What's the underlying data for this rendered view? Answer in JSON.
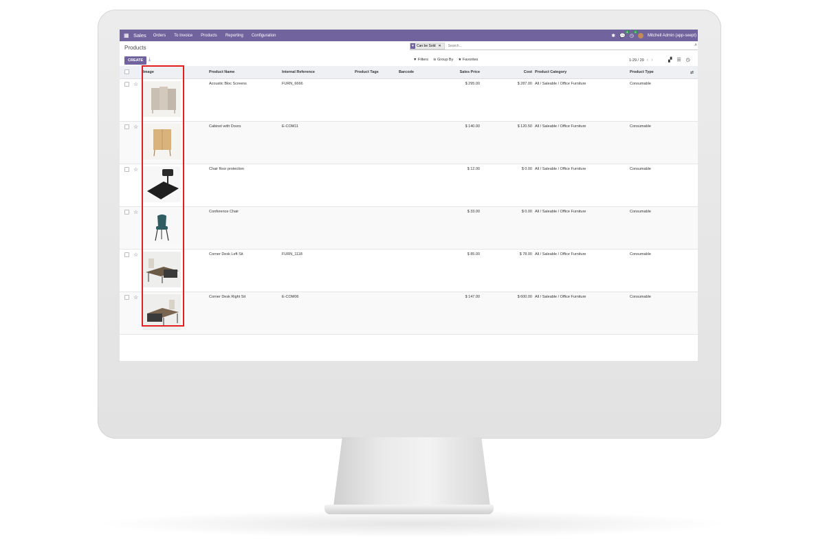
{
  "navbar": {
    "app_name": "Sales",
    "menu": [
      "Orders",
      "To Invoice",
      "Products",
      "Reporting",
      "Configuration"
    ],
    "chat_badge": "4",
    "activity_badge": "2",
    "user": "Mitchell Admin (app-seept)"
  },
  "control_panel": {
    "breadcrumb": "Products",
    "facet_label": "Can be Sold",
    "search_placeholder": "Search...",
    "create_label": "CREATE",
    "filters_label": "Filters",
    "group_by_label": "Group By",
    "favorites_label": "Favorites",
    "pager": "1-29 / 29"
  },
  "table": {
    "headers": {
      "image": "Image",
      "name": "Product Name",
      "ref": "Internal Reference",
      "tags": "Product Tags",
      "barcode": "Barcode",
      "price": "Sales Price",
      "cost": "Cost",
      "category": "Product Category",
      "type": "Product Type"
    },
    "rows": [
      {
        "name": "Acoustic Bloc Screens",
        "ref": "FURN_6666",
        "price": "$ 295.00",
        "cost": "$ 287.00",
        "category": "All / Saleable / Office Furniture",
        "type": "Consumable"
      },
      {
        "name": "Cabinet with Doors",
        "ref": "E-COM11",
        "price": "$ 140.00",
        "cost": "$ 120.50",
        "category": "All / Saleable / Office Furniture",
        "type": "Consumable"
      },
      {
        "name": "Chair floor protection",
        "ref": "",
        "price": "$ 12.00",
        "cost": "$ 0.00",
        "category": "All / Saleable / Office Furniture",
        "type": "Consumable"
      },
      {
        "name": "Conference Chair",
        "ref": "",
        "price": "$ 33.00",
        "cost": "$ 0.00",
        "category": "All / Saleable / Office Furniture",
        "type": "Consumable"
      },
      {
        "name": "Corner Desk Left Sit",
        "ref": "FURN_1118",
        "price": "$ 85.00",
        "cost": "$ 78.00",
        "category": "All / Saleable / Office Furniture",
        "type": "Consumable"
      },
      {
        "name": "Corner Desk Right Sit",
        "ref": "E-COM06",
        "price": "$ 147.00",
        "cost": "$ 600.00",
        "category": "All / Saleable / Office Furniture",
        "type": "Consumable"
      }
    ]
  }
}
